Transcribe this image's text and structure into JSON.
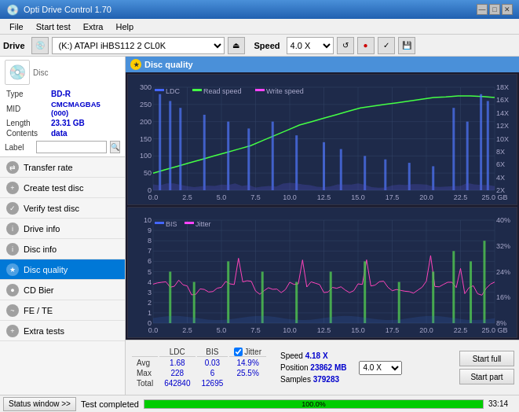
{
  "app": {
    "title": "Opti Drive Control 1.70",
    "title_icon": "💿"
  },
  "titlebar": {
    "title": "Opti Drive Control 1.70",
    "minimize": "—",
    "maximize": "□",
    "close": "✕"
  },
  "menubar": {
    "items": [
      "File",
      "Start test",
      "Extra",
      "Help"
    ]
  },
  "drive_toolbar": {
    "drive_label": "Drive",
    "drive_value": "(K:)  ATAPI iHBS112  2 CL0K",
    "speed_label": "Speed",
    "speed_value": "4.0 X"
  },
  "disc_panel": {
    "type_label": "Type",
    "type_value": "BD-R",
    "mid_label": "MID",
    "mid_value": "CMCMAGBA5 (000)",
    "length_label": "Length",
    "length_value": "23.31 GB",
    "contents_label": "Contents",
    "contents_value": "data",
    "label_label": "Label",
    "label_value": ""
  },
  "nav": {
    "items": [
      {
        "id": "transfer-rate",
        "label": "Transfer rate",
        "icon": "⇄"
      },
      {
        "id": "create-test-disc",
        "label": "Create test disc",
        "icon": "+"
      },
      {
        "id": "verify-test-disc",
        "label": "Verify test disc",
        "icon": "✓"
      },
      {
        "id": "drive-info",
        "label": "Drive info",
        "icon": "i"
      },
      {
        "id": "disc-info",
        "label": "Disc info",
        "icon": "i"
      },
      {
        "id": "disc-quality",
        "label": "Disc quality",
        "icon": "★",
        "active": true
      },
      {
        "id": "cd-bier",
        "label": "CD Bier",
        "icon": "●"
      },
      {
        "id": "fe-te",
        "label": "FE / TE",
        "icon": "~"
      },
      {
        "id": "extra-tests",
        "label": "Extra tests",
        "icon": "+"
      }
    ]
  },
  "disc_quality": {
    "title": "Disc quality",
    "chart1": {
      "legend": [
        {
          "label": "LDC",
          "color": "#4444ff"
        },
        {
          "label": "Read speed",
          "color": "#44ff44"
        },
        {
          "label": "Write speed",
          "color": "#ff44ff"
        }
      ],
      "y_max": 300,
      "y_right_labels": [
        "18X",
        "16X",
        "14X",
        "12X",
        "10X",
        "8X",
        "6X",
        "4X",
        "2X"
      ],
      "x_labels": [
        "0.0",
        "2.5",
        "5.0",
        "7.5",
        "10.0",
        "12.5",
        "15.0",
        "17.5",
        "20.0",
        "22.5",
        "25.0 GB"
      ]
    },
    "chart2": {
      "legend": [
        {
          "label": "BIS",
          "color": "#4444ff"
        },
        {
          "label": "Jitter",
          "color": "#ff44ff"
        }
      ],
      "y_max": 10,
      "y_right_labels": [
        "40%",
        "32%",
        "24%",
        "16%",
        "8%"
      ],
      "x_labels": [
        "0.0",
        "2.5",
        "5.0",
        "7.5",
        "10.0",
        "12.5",
        "15.0",
        "17.5",
        "20.0",
        "22.5",
        "25.0 GB"
      ]
    }
  },
  "stats": {
    "columns": [
      "LDC",
      "BIS",
      "",
      "Jitter",
      "Speed",
      ""
    ],
    "rows": [
      {
        "label": "Avg",
        "ldc": "1.68",
        "bis": "0.03",
        "jitter": "14.9%",
        "speed_label": "Speed",
        "speed_val": "4.18 X",
        "speed_select": "4.0 X"
      },
      {
        "label": "Max",
        "ldc": "228",
        "bis": "6",
        "jitter": "25.5%",
        "position_label": "Position",
        "position_val": "23862 MB"
      },
      {
        "label": "Total",
        "ldc": "642840",
        "bis": "12695",
        "jitter": "",
        "samples_label": "Samples",
        "samples_val": "379283"
      }
    ],
    "jitter_checked": true,
    "jitter_label": "Jitter",
    "start_full_label": "Start full",
    "start_part_label": "Start part"
  },
  "statusbar": {
    "status_window_btn": "Status window >>",
    "status_text": "Test completed",
    "progress_pct": 100,
    "progress_label": "100.0%",
    "time": "33:14"
  }
}
